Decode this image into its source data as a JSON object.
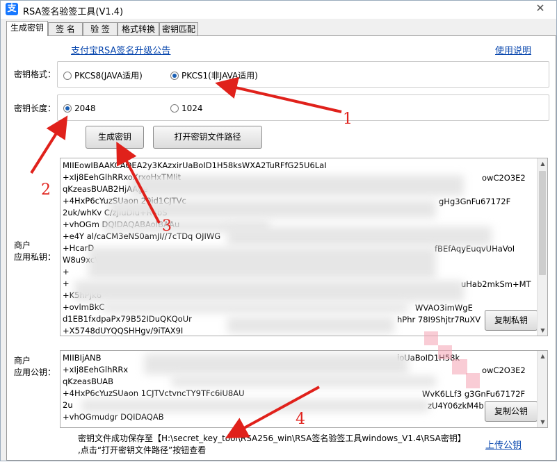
{
  "window": {
    "title": "RSA签名验签工具(V1.4)",
    "app_icon_glyph": "支",
    "close_glyph": "✕"
  },
  "tabs": [
    {
      "label": "生成密钥",
      "active": true
    },
    {
      "label": "签 名"
    },
    {
      "label": "验 签"
    },
    {
      "label": "格式转换"
    },
    {
      "label": "密钥匹配"
    }
  ],
  "links": {
    "announcement": "支付宝RSA签名升级公告",
    "help": "使用说明",
    "upload": "上传公钥"
  },
  "key_format": {
    "label": "密钥格式：",
    "options": [
      {
        "label": "PKCS8(JAVA适用)",
        "selected": false
      },
      {
        "label": "PKCS1(非JAVA适用)",
        "selected": true
      }
    ]
  },
  "key_length": {
    "label": "密钥长度：",
    "options": [
      {
        "label": "2048",
        "selected": true
      },
      {
        "label": "1024",
        "selected": false
      }
    ]
  },
  "buttons": {
    "generate": "生成密钥",
    "open_path": "打开密钥文件路径",
    "copy_private": "复制私钥",
    "copy_public": "复制公钥"
  },
  "private_key": {
    "label_line1": "商户",
    "label_line2": "应用私钥：",
    "lines": [
      "MIIEowIBAAKCAQEA2y3KAzxirUaBoID1H58ksWXA2TuRFfG25U6LaI",
      "+xIj8EehGlhRRxoXrxoHxTMIit",
      "qKzeasBUAB2HjAAge",
      "+4HxP6cYuzSUaon 20id1CJTVc",
      "2uk/whKv C/zJiuDlu+R4bS",
      "+vhOGm DQIDAQABAoIBAAu",
      "+e4Y al/caCM3eNS0amJI//7cTDq OJIWG",
      "+HcarD",
      "W8u9xcV",
      "+",
      "+",
      "+K5hPJk6",
      "+ovlmBkC",
      "d1EB1fxdpaPx79B52IDuQKQoUr",
      "+X5748dUYQQSHHgv/9iTAX9I"
    ],
    "right_fragments": [
      "owC2O3E2",
      "gHg3GnFu67172F",
      "fBEfAqyEuqvUHaVoI",
      "uHab2mkSm+MT",
      "WVAO3imWgE",
      "hPhr 78I9Shjtr7RuXV"
    ]
  },
  "public_key": {
    "label_line1": "商户",
    "label_line2": "应用公钥：",
    "lines": [
      "MIIBIjANB",
      "+xIj8EehGlhRRx",
      "qKzeasBUAB",
      "+4HxP6cYuzSUaon 1CJTVctvncTY9TFc6iU8AU",
      "2u",
      "+vhOGmudgr DQIDAQAB"
    ],
    "right_fragments": [
      "ioUaBoID1H58k",
      "owC2O3E2",
      "WvK6LLf3 g3GnFu67172F",
      "zU4Y06zkM4b"
    ]
  },
  "status": {
    "line1": "密钥文件成功保存至【H:\\secret_key_tool\\RSA256_win\\RSA签名验签工具windows_V1.4\\RSA密钥】",
    "line2": ",点击“打开密钥文件路径”按钮查看"
  },
  "annotations": [
    "1",
    "2",
    "3",
    "4"
  ],
  "colors": {
    "annotation": "#e0211b",
    "link": "#0645ad",
    "radio_selected": "#1a5fb4"
  }
}
